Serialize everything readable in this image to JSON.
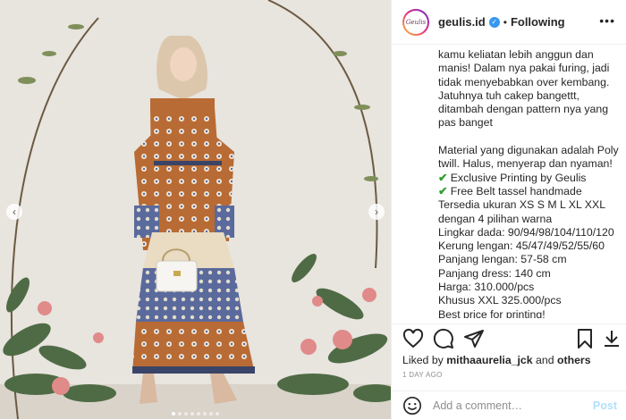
{
  "header": {
    "avatar_text": "Geulis",
    "username": "geulis.id",
    "verified": true,
    "separator": "•",
    "follow_status": "Following",
    "more_icon": "more-horizontal-icon"
  },
  "caption_lines": [
    "kamu keliatan lebih anggun dan",
    "manis! Dalam nya pakai furing, jadi",
    "tidak menyebabkan over kembang.",
    "Jatuhnya tuh cakep bangettt,",
    "ditambah dengan pattern nya yang",
    "pas banget",
    "",
    "Material yang digunakan adalah Poly",
    "twill. Halus, menyerap dan nyaman!"
  ],
  "caption_checks": [
    {
      "icon": "✔",
      "text": " Exclusive Printing by Geulis"
    },
    {
      "icon": "✔",
      "text": " Free Belt tassel handmade"
    }
  ],
  "caption_details": [
    "Tersedia ukuran XS S M L XL XXL",
    "dengan 4 pilihan warna",
    "Lingkar dada: 90/94/98/104/110/120",
    "Kerung lengan: 45/47/49/52/55/60",
    "Panjang lengan: 57-58 cm",
    "Panjang dress: 140 cm",
    "Harga: 310.000/pcs",
    "Khusus XXL 325.000/pcs",
    "Best price for printing!"
  ],
  "likes": {
    "prefix": "Liked by ",
    "user": "mithaaurelia_jck",
    "middle": " and ",
    "others": "others"
  },
  "time_ago": "1 DAY AGO",
  "comment": {
    "placeholder": "Add a comment…",
    "post_label": "Post"
  },
  "carousel": {
    "prev_icon": "‹",
    "next_icon": "›",
    "dots": 8,
    "active_index": 0
  },
  "colors": {
    "verified": "#3897f0",
    "check": "#2f9e2f",
    "post_disabled": "#b2dffc",
    "dress_orange": "#b86b34",
    "dress_blue": "#5a6a9c"
  }
}
